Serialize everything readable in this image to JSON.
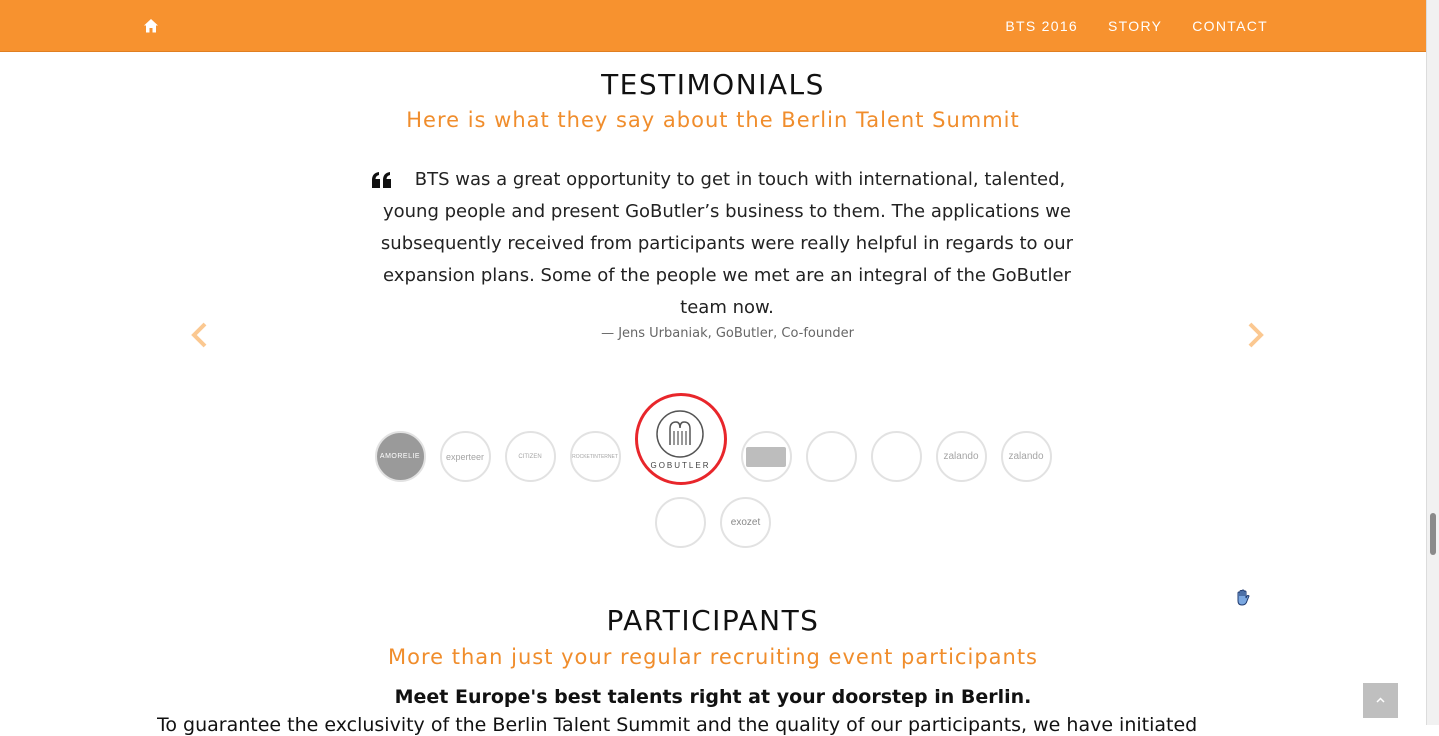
{
  "navbar": {
    "home_icon": "home-icon",
    "links": [
      {
        "label": "BTS 2016"
      },
      {
        "label": "STORY"
      },
      {
        "label": "CONTACT"
      }
    ],
    "background_color": "#f7922f"
  },
  "testimonials": {
    "title": "TESTIMONIALS",
    "subtitle": "Here is what they say about the Berlin Talent Summit",
    "quote_icon": "quote-left-icon",
    "quote": "BTS was a great opportunity to get in touch with international, talented, young people and present GoButler’s business to them. The applications we subsequently received from participants were really helpful in regards to our expansion plans. Some of the people we met are an integral of the GoButler team now.",
    "author": "— Jens Urbaniak, GoButler, Co-founder",
    "prev_icon": "chevron-left-icon",
    "next_icon": "chevron-right-icon"
  },
  "logos": {
    "row1": [
      {
        "label": "AMORELIE"
      },
      {
        "label": "experteer"
      },
      {
        "label": "CITIZEN"
      },
      {
        "label": "ROCKETINTERNET"
      },
      {
        "label": "GOBUTLER"
      },
      {
        "label": ""
      },
      {
        "label": ""
      },
      {
        "label": ""
      },
      {
        "label": "zalando"
      },
      {
        "label": "zalando"
      }
    ],
    "row2": [
      {
        "label": ""
      },
      {
        "label": "exozet"
      }
    ],
    "active_index": 4,
    "active_border_color": "#e8262b"
  },
  "participants": {
    "title": "PARTICIPANTS",
    "subtitle": "More than just your regular recruiting event participants",
    "lead": "Meet Europe's best talents right at your doorstep in Berlin.",
    "body_partial": "To guarantee the exclusivity of the Berlin Talent Summit and the quality of our participants, we have initiated"
  },
  "accent_color": "#f08d2c"
}
